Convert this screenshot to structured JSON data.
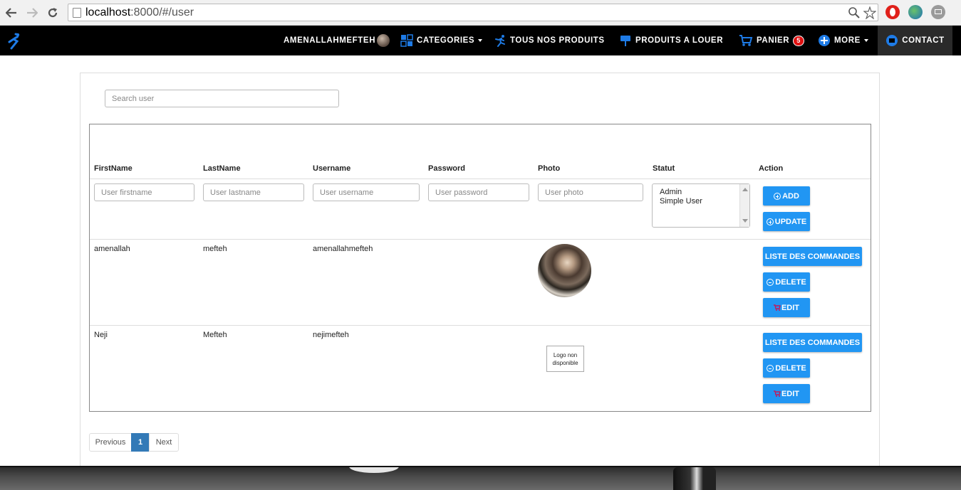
{
  "browser": {
    "url_host": "localhost",
    "url_rest": ":8000/#/user"
  },
  "navbar": {
    "user": "AMENALLAHMEFTEH",
    "categories": "CATEGORIES",
    "products": "TOUS NOS PRODUITS",
    "rent": "PRODUITS A LOUER",
    "cart": "PANIER",
    "cart_count": "5",
    "more": "MORE",
    "contact": "CONTACT"
  },
  "search": {
    "placeholder": "Search user"
  },
  "table": {
    "headers": [
      "FirstName",
      "LastName",
      "Username",
      "Password",
      "Photo",
      "Statut",
      "Action"
    ],
    "form": {
      "firstname_placeholder": "User firstname",
      "lastname_placeholder": "User lastname",
      "username_placeholder": "User username",
      "password_placeholder": "User password",
      "photo_placeholder": "User photo",
      "statut_options": [
        "Admin",
        "Simple User"
      ],
      "add_label": "ADD",
      "update_label": "UPDATE"
    },
    "rows": [
      {
        "firstname": "amenallah",
        "lastname": "mefteh",
        "username": "amenallahmefteh",
        "photo": "avatar"
      },
      {
        "firstname": "Neji",
        "lastname": "Mefteh",
        "username": "nejimefteh",
        "photo": "Logo non disponible"
      }
    ],
    "row_actions": {
      "orders": "LISTE DES COMMANDES",
      "delete": "DELETE",
      "edit": "EDIT"
    }
  },
  "pagination": {
    "previous": "Previous",
    "current": "1",
    "next": "Next"
  },
  "colors": {
    "accent": "#2196f3",
    "navbar": "#000000",
    "pager_active": "#337ab7",
    "badge": "#e01010"
  },
  "icons": [
    "back-icon",
    "forward-icon",
    "reload-icon",
    "zoom-icon",
    "star-icon",
    "categories-icon",
    "runner-icon",
    "sign-icon",
    "cart-icon",
    "plus-circle-icon",
    "contact-icon"
  ]
}
